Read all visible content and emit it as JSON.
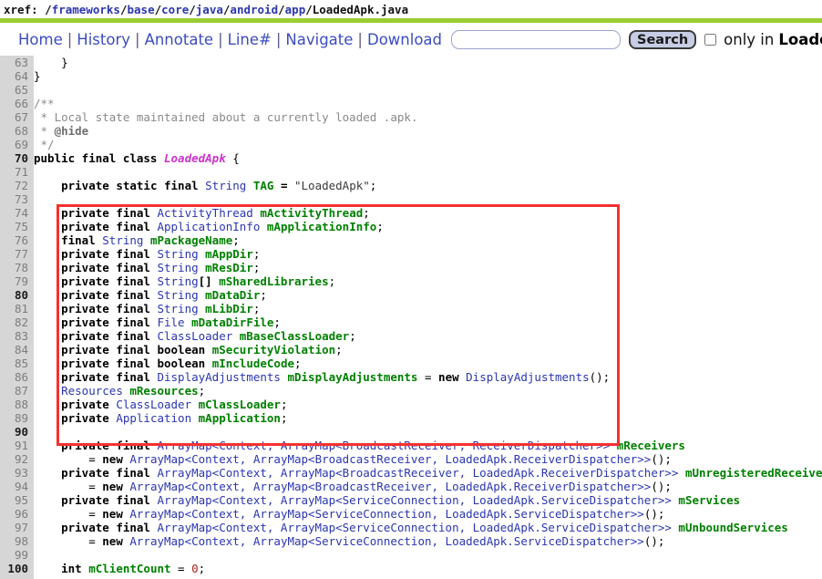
{
  "xref": {
    "label": "xref:",
    "segments": [
      {
        "text": "/",
        "link": false
      },
      {
        "text": "frameworks",
        "link": true
      },
      {
        "text": "/",
        "link": false
      },
      {
        "text": "base",
        "link": true
      },
      {
        "text": "/",
        "link": false
      },
      {
        "text": "core",
        "link": true
      },
      {
        "text": "/",
        "link": false
      },
      {
        "text": "java",
        "link": true
      },
      {
        "text": "/",
        "link": false
      },
      {
        "text": "android",
        "link": true
      },
      {
        "text": "/",
        "link": false
      },
      {
        "text": "app",
        "link": true
      },
      {
        "text": "/",
        "link": false
      },
      {
        "text": "LoadedApk.java",
        "link": false
      }
    ],
    "full_path": "/frameworks/base/core/java/android/app/LoadedApk.java"
  },
  "nav": {
    "links": [
      "Home",
      "History",
      "Annotate",
      "Line#",
      "Navigate",
      "Download"
    ],
    "separator": "|"
  },
  "search": {
    "value": "",
    "placeholder": "",
    "button_label": "Search",
    "only_in_label": "only in",
    "only_in_file": "LoadedApk.java",
    "only_in_checked": false
  },
  "colors": {
    "divider": "#9acd32",
    "annotation_box": "#f53131",
    "gutter": "#d6d6d6",
    "link": "#3b4cc0",
    "type": "#2b36b0",
    "identifier": "#008000",
    "comment": "#8a8a8a",
    "classname": "#cc33cc",
    "number": "#b22222",
    "button_fill": "#c6cde4"
  },
  "code": {
    "first_line": 63,
    "last_line": 100,
    "lines": [
      {
        "n": 63,
        "tokens": [
          {
            "t": "    }",
            "c": "pl"
          }
        ]
      },
      {
        "n": 64,
        "tokens": [
          {
            "t": "}",
            "c": "pl"
          }
        ]
      },
      {
        "n": 65,
        "tokens": []
      },
      {
        "n": 66,
        "tokens": [
          {
            "t": "/**",
            "c": "cmt"
          }
        ]
      },
      {
        "n": 67,
        "tokens": [
          {
            "t": " * Local state maintained about a currently loaded .apk.",
            "c": "cmt"
          }
        ]
      },
      {
        "n": 68,
        "tokens": [
          {
            "t": " * ",
            "c": "cmt"
          },
          {
            "t": "@hide",
            "c": "cmtb"
          }
        ]
      },
      {
        "n": 69,
        "tokens": [
          {
            "t": " */",
            "c": "cmt"
          }
        ]
      },
      {
        "n": 70,
        "tokens": [
          {
            "t": "public final class ",
            "c": "kw"
          },
          {
            "t": "LoadedApk",
            "c": "cls"
          },
          {
            "t": " {",
            "c": "pl"
          }
        ]
      },
      {
        "n": 71,
        "tokens": []
      },
      {
        "n": 72,
        "tokens": [
          {
            "t": "    ",
            "c": "pl"
          },
          {
            "t": "private static final ",
            "c": "kw"
          },
          {
            "t": "String ",
            "c": "typ"
          },
          {
            "t": "TAG",
            "c": "var"
          },
          {
            "t": " = ",
            "c": "kw"
          },
          {
            "t": "\"LoadedApk\"",
            "c": "str"
          },
          {
            "t": ";",
            "c": "pl"
          }
        ]
      },
      {
        "n": 73,
        "tokens": []
      },
      {
        "n": 74,
        "tokens": [
          {
            "t": "    ",
            "c": "pl"
          },
          {
            "t": "private final ",
            "c": "kw"
          },
          {
            "t": "ActivityThread ",
            "c": "typ"
          },
          {
            "t": "mActivityThread",
            "c": "var"
          },
          {
            "t": ";",
            "c": "pl"
          }
        ]
      },
      {
        "n": 75,
        "tokens": [
          {
            "t": "    ",
            "c": "pl"
          },
          {
            "t": "private final ",
            "c": "kw"
          },
          {
            "t": "ApplicationInfo ",
            "c": "typ"
          },
          {
            "t": "mApplicationInfo",
            "c": "var"
          },
          {
            "t": ";",
            "c": "pl"
          }
        ]
      },
      {
        "n": 76,
        "tokens": [
          {
            "t": "    ",
            "c": "pl"
          },
          {
            "t": "final ",
            "c": "kw"
          },
          {
            "t": "String ",
            "c": "typ"
          },
          {
            "t": "mPackageName",
            "c": "var"
          },
          {
            "t": ";",
            "c": "pl"
          }
        ]
      },
      {
        "n": 77,
        "tokens": [
          {
            "t": "    ",
            "c": "pl"
          },
          {
            "t": "private final ",
            "c": "kw"
          },
          {
            "t": "String ",
            "c": "typ"
          },
          {
            "t": "mAppDir",
            "c": "var"
          },
          {
            "t": ";",
            "c": "pl"
          }
        ]
      },
      {
        "n": 78,
        "tokens": [
          {
            "t": "    ",
            "c": "pl"
          },
          {
            "t": "private final ",
            "c": "kw"
          },
          {
            "t": "String ",
            "c": "typ"
          },
          {
            "t": "mResDir",
            "c": "var"
          },
          {
            "t": ";",
            "c": "pl"
          }
        ]
      },
      {
        "n": 79,
        "tokens": [
          {
            "t": "    ",
            "c": "pl"
          },
          {
            "t": "private final ",
            "c": "kw"
          },
          {
            "t": "String",
            "c": "typ"
          },
          {
            "t": "[] ",
            "c": "kw"
          },
          {
            "t": "mSharedLibraries",
            "c": "var"
          },
          {
            "t": ";",
            "c": "pl"
          }
        ]
      },
      {
        "n": 80,
        "tokens": [
          {
            "t": "    ",
            "c": "pl"
          },
          {
            "t": "private final ",
            "c": "kw"
          },
          {
            "t": "String ",
            "c": "typ"
          },
          {
            "t": "mDataDir",
            "c": "var"
          },
          {
            "t": ";",
            "c": "pl"
          }
        ]
      },
      {
        "n": 81,
        "tokens": [
          {
            "t": "    ",
            "c": "pl"
          },
          {
            "t": "private final ",
            "c": "kw"
          },
          {
            "t": "String ",
            "c": "typ"
          },
          {
            "t": "mLibDir",
            "c": "var"
          },
          {
            "t": ";",
            "c": "pl"
          }
        ]
      },
      {
        "n": 82,
        "tokens": [
          {
            "t": "    ",
            "c": "pl"
          },
          {
            "t": "private final ",
            "c": "kw"
          },
          {
            "t": "File ",
            "c": "typ"
          },
          {
            "t": "mDataDirFile",
            "c": "var"
          },
          {
            "t": ";",
            "c": "pl"
          }
        ]
      },
      {
        "n": 83,
        "tokens": [
          {
            "t": "    ",
            "c": "pl"
          },
          {
            "t": "private final ",
            "c": "kw"
          },
          {
            "t": "ClassLoader ",
            "c": "typ"
          },
          {
            "t": "mBaseClassLoader",
            "c": "var"
          },
          {
            "t": ";",
            "c": "pl"
          }
        ]
      },
      {
        "n": 84,
        "tokens": [
          {
            "t": "    ",
            "c": "pl"
          },
          {
            "t": "private final boolean ",
            "c": "kw"
          },
          {
            "t": "mSecurityViolation",
            "c": "var"
          },
          {
            "t": ";",
            "c": "pl"
          }
        ]
      },
      {
        "n": 85,
        "tokens": [
          {
            "t": "    ",
            "c": "pl"
          },
          {
            "t": "private final boolean ",
            "c": "kw"
          },
          {
            "t": "mIncludeCode",
            "c": "var"
          },
          {
            "t": ";",
            "c": "pl"
          }
        ]
      },
      {
        "n": 86,
        "tokens": [
          {
            "t": "    ",
            "c": "pl"
          },
          {
            "t": "private final ",
            "c": "kw"
          },
          {
            "t": "DisplayAdjustments ",
            "c": "typ"
          },
          {
            "t": "mDisplayAdjustments",
            "c": "var"
          },
          {
            "t": " = ",
            "c": "pl"
          },
          {
            "t": "new ",
            "c": "kw"
          },
          {
            "t": "DisplayAdjustments",
            "c": "typ"
          },
          {
            "t": "();",
            "c": "pl"
          }
        ]
      },
      {
        "n": 87,
        "tokens": [
          {
            "t": "    ",
            "c": "pl"
          },
          {
            "t": "Resources ",
            "c": "typ"
          },
          {
            "t": "mResources",
            "c": "var"
          },
          {
            "t": ";",
            "c": "pl"
          }
        ]
      },
      {
        "n": 88,
        "tokens": [
          {
            "t": "    ",
            "c": "pl"
          },
          {
            "t": "private ",
            "c": "kw"
          },
          {
            "t": "ClassLoader ",
            "c": "typ"
          },
          {
            "t": "mClassLoader",
            "c": "var"
          },
          {
            "t": ";",
            "c": "pl"
          }
        ]
      },
      {
        "n": 89,
        "tokens": [
          {
            "t": "    ",
            "c": "pl"
          },
          {
            "t": "private ",
            "c": "kw"
          },
          {
            "t": "Application ",
            "c": "typ"
          },
          {
            "t": "mApplication",
            "c": "var"
          },
          {
            "t": ";",
            "c": "pl"
          }
        ]
      },
      {
        "n": 90,
        "tokens": []
      },
      {
        "n": 91,
        "tokens": [
          {
            "t": "    ",
            "c": "pl"
          },
          {
            "t": "private final ",
            "c": "kw"
          },
          {
            "t": "ArrayMap<Context, ArrayMap<BroadcastReceiver, ReceiverDispatcher>> ",
            "c": "typ"
          },
          {
            "t": "mReceivers",
            "c": "var"
          }
        ]
      },
      {
        "n": 92,
        "tokens": [
          {
            "t": "        = ",
            "c": "pl"
          },
          {
            "t": "new ",
            "c": "kw"
          },
          {
            "t": "ArrayMap<Context, ArrayMap<BroadcastReceiver, LoadedApk.ReceiverDispatcher>>",
            "c": "typ"
          },
          {
            "t": "();",
            "c": "pl"
          }
        ]
      },
      {
        "n": 93,
        "tokens": [
          {
            "t": "    ",
            "c": "pl"
          },
          {
            "t": "private final ",
            "c": "kw"
          },
          {
            "t": "ArrayMap<Context, ArrayMap<BroadcastReceiver, LoadedApk.ReceiverDispatcher>> ",
            "c": "typ"
          },
          {
            "t": "mUnregisteredReceivers",
            "c": "var"
          }
        ]
      },
      {
        "n": 94,
        "tokens": [
          {
            "t": "        = ",
            "c": "pl"
          },
          {
            "t": "new ",
            "c": "kw"
          },
          {
            "t": "ArrayMap<Context, ArrayMap<BroadcastReceiver, LoadedApk.ReceiverDispatcher>>",
            "c": "typ"
          },
          {
            "t": "();",
            "c": "pl"
          }
        ]
      },
      {
        "n": 95,
        "tokens": [
          {
            "t": "    ",
            "c": "pl"
          },
          {
            "t": "private final ",
            "c": "kw"
          },
          {
            "t": "ArrayMap<Context, ArrayMap<ServiceConnection, LoadedApk.ServiceDispatcher>> ",
            "c": "typ"
          },
          {
            "t": "mServices",
            "c": "var"
          }
        ]
      },
      {
        "n": 96,
        "tokens": [
          {
            "t": "        = ",
            "c": "pl"
          },
          {
            "t": "new ",
            "c": "kw"
          },
          {
            "t": "ArrayMap<Context, ArrayMap<ServiceConnection, LoadedApk.ServiceDispatcher>>",
            "c": "typ"
          },
          {
            "t": "();",
            "c": "pl"
          }
        ]
      },
      {
        "n": 97,
        "tokens": [
          {
            "t": "    ",
            "c": "pl"
          },
          {
            "t": "private final ",
            "c": "kw"
          },
          {
            "t": "ArrayMap<Context, ArrayMap<ServiceConnection, LoadedApk.ServiceDispatcher>> ",
            "c": "typ"
          },
          {
            "t": "mUnboundServices",
            "c": "var"
          }
        ]
      },
      {
        "n": 98,
        "tokens": [
          {
            "t": "        = ",
            "c": "pl"
          },
          {
            "t": "new ",
            "c": "kw"
          },
          {
            "t": "ArrayMap<Context, ArrayMap<ServiceConnection, LoadedApk.ServiceDispatcher>>",
            "c": "typ"
          },
          {
            "t": "();",
            "c": "pl"
          }
        ]
      },
      {
        "n": 99,
        "tokens": []
      },
      {
        "n": 100,
        "tokens": [
          {
            "t": "    ",
            "c": "pl"
          },
          {
            "t": "int ",
            "c": "kw"
          },
          {
            "t": "mClientCount",
            "c": "var"
          },
          {
            "t": " = ",
            "c": "pl"
          },
          {
            "t": "0",
            "c": "num"
          },
          {
            "t": ";",
            "c": "pl"
          }
        ]
      }
    ]
  },
  "annotation": {
    "type": "rectangle",
    "color": "#f53131",
    "covers_lines": "74-89"
  }
}
